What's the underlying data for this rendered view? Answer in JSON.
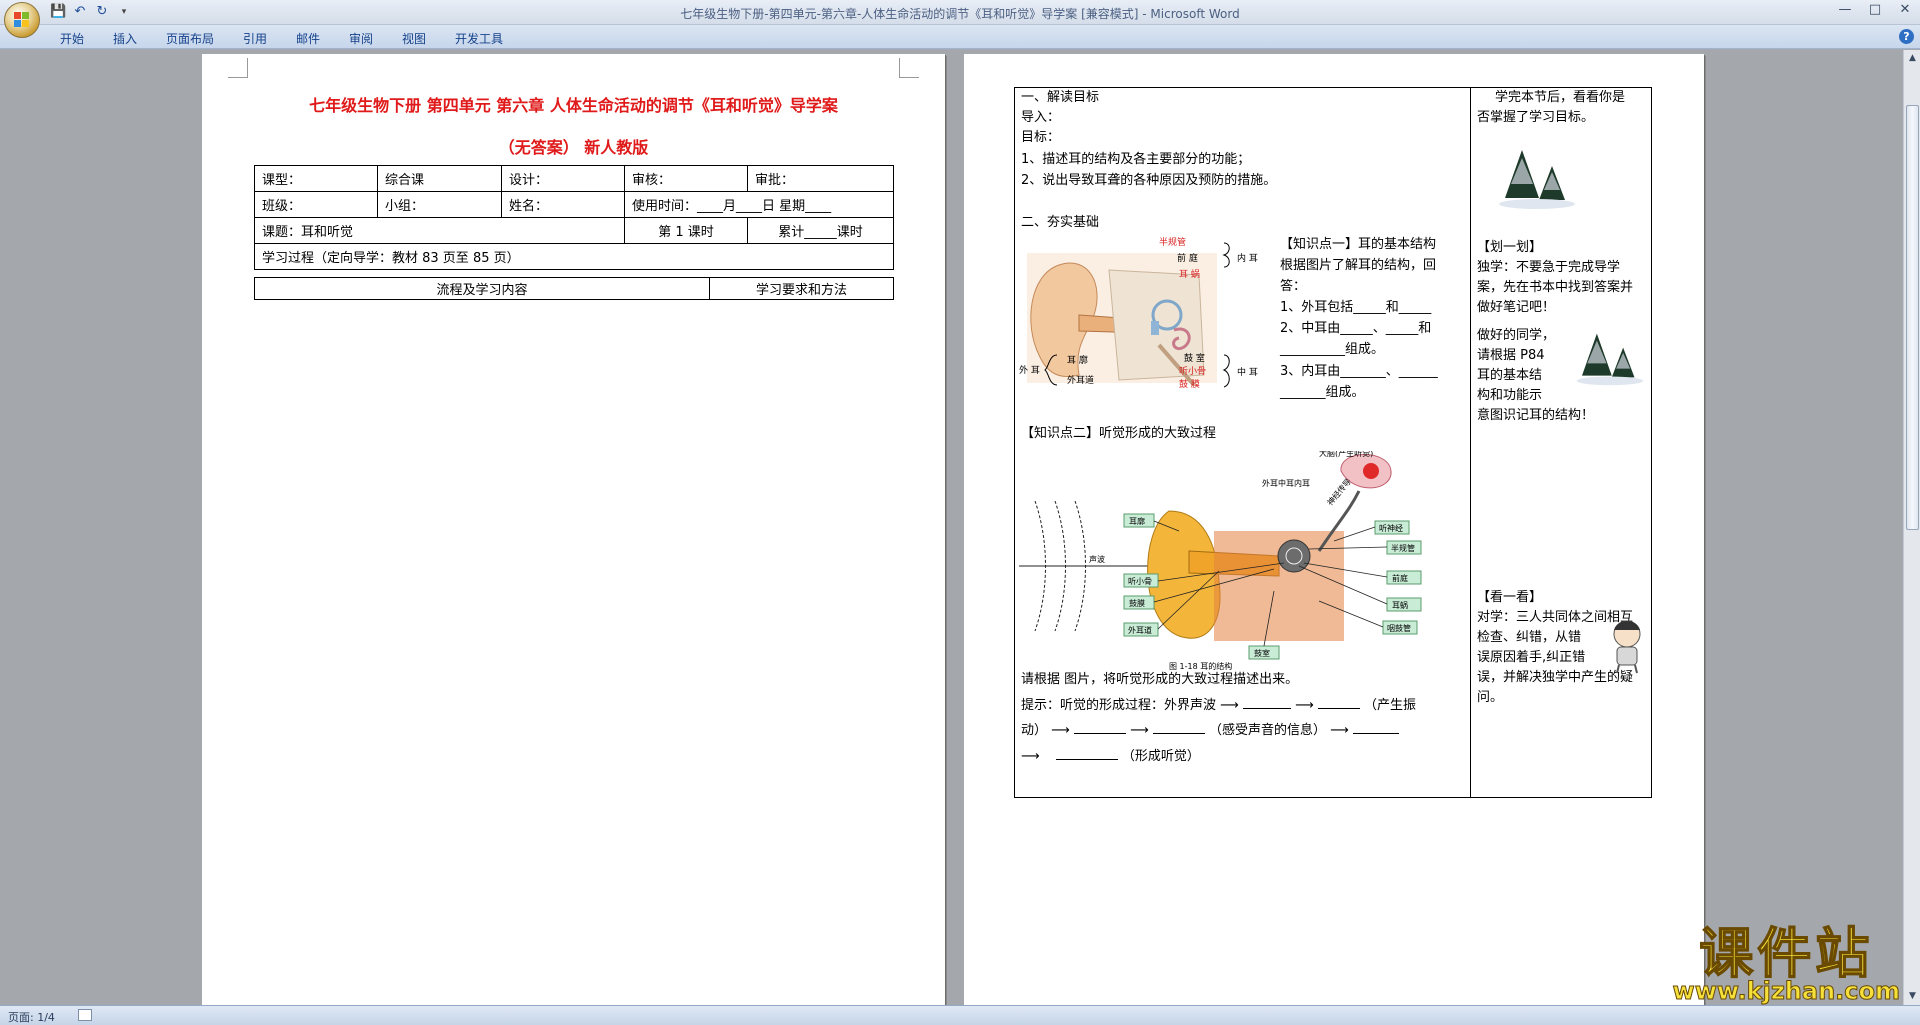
{
  "window": {
    "title": "七年级生物下册-第四单元-第六章-人体生命活动的调节《耳和听觉》导学案 [兼容模式] - Microsoft Word",
    "controls": [
      "minimize",
      "maximize",
      "close"
    ]
  },
  "quick_access": [
    "save-icon",
    "undo-icon",
    "redo-icon",
    "customize-icon"
  ],
  "ribbon": {
    "tabs": [
      "开始",
      "插入",
      "页面布局",
      "引用",
      "邮件",
      "审阅",
      "视图",
      "开发工具"
    ]
  },
  "left_page": {
    "title_line1": "七年级生物下册 第四单元 第六章 人体生命活动的调节《耳和听觉》导学案",
    "title_line2": "（无答案） 新人教版",
    "table": {
      "r1": [
        "课型：",
        "综合课",
        "设计：",
        "审核：",
        "审批："
      ],
      "r2": [
        "班级：",
        "小组：",
        "姓名：",
        "使用时间：____月____日 星期____"
      ],
      "r3": [
        "课题：耳和听觉",
        "第 1 课时",
        "累计_____课时"
      ],
      "r4": "学习过程（定向导学：教材 83 页至 85 页）",
      "r5": [
        "流程及学习内容",
        "学习要求和方法"
      ]
    }
  },
  "right_page": {
    "left_col": {
      "l1": "一、解读目标",
      "l2": "导入：",
      "l3": "目标：",
      "l4": "1、描述耳的结构及各主要部分的功能；",
      "l5": "2、说出导致耳聋的各种原因及预防的措施。",
      "l6": "二、夯实基础",
      "kp1_title": "【知识点一】耳的基本结构",
      "kp1_l1": "根据图片了解耳的结构，回",
      "kp1_l2": "答：",
      "kp1_q1": "1、外耳包括_____和_____",
      "kp1_q2": "2、中耳由_____、_____和",
      "kp1_q2b": "__________组成。",
      "kp1_q3": "3、内耳由_______、______",
      "kp1_q3b": "_______组成。",
      "kp2_title": "【知识点二】听觉形成的大致过程",
      "caption": "图 1-18   耳的结构",
      "ask": "请根据 图片，将听觉形成的大致过程描述出来。",
      "hint1": "提示：听觉的形成过程：外界声波",
      "hint1b": "（产生振",
      "hint2": "动）",
      "hint2b": "（感受声音的信息）",
      "hint3": "（形成听觉）"
    },
    "right_col": {
      "r1": "学完本节后，看看你是",
      "r2": "否掌握了学习目标。",
      "r3": "【划一划】",
      "r4": "独学：不要急于完成导学",
      "r5": "案，先在书本中找到答案并",
      "r6": "做好笔记吧！",
      "r7": "做好的同学，",
      "r8": "请根据 P84",
      "r9": "耳的基本结",
      "r10": "构和功能示",
      "r11": "意图识记耳的结构！",
      "r12": "【看一看】",
      "r13": "对学：三人共同体之间相互",
      "r14": "检查、纠错，从错",
      "r15": "误原因着手,纠正错",
      "r16": "误，并解决独学中产生的疑",
      "r17": "问。"
    },
    "ear1_labels": {
      "a": "半规管",
      "b": "前 庭",
      "c": "耳 蜗",
      "d": "内 耳",
      "e": "鼓 室",
      "f": "听小骨",
      "g": "鼓 膜",
      "h": "中 耳",
      "i": "耳 廓",
      "j": "外耳道",
      "k": "外 耳"
    },
    "ear2_labels": {
      "brain": "大脑(产生听觉)",
      "tags": [
        "外耳",
        "中耳",
        "内耳"
      ],
      "nerve_path": "神经传导",
      "sound": "声波",
      "a": "耳廓",
      "b": "听小骨",
      "c": "鼓膜",
      "d": "外耳道",
      "e": "听神经",
      "f": "半规管",
      "g": "前庭",
      "h": "耳蜗",
      "i": "咽鼓管",
      "j": "鼓室"
    }
  },
  "statusbar": {
    "page": "页面: 1/4"
  },
  "watermark": {
    "text": "课件站",
    "url": "www.kjzhan.com"
  },
  "colors": {
    "title_red": "#e01a1a",
    "label_red": "#d82020",
    "label_green": "#2c7a3a"
  }
}
